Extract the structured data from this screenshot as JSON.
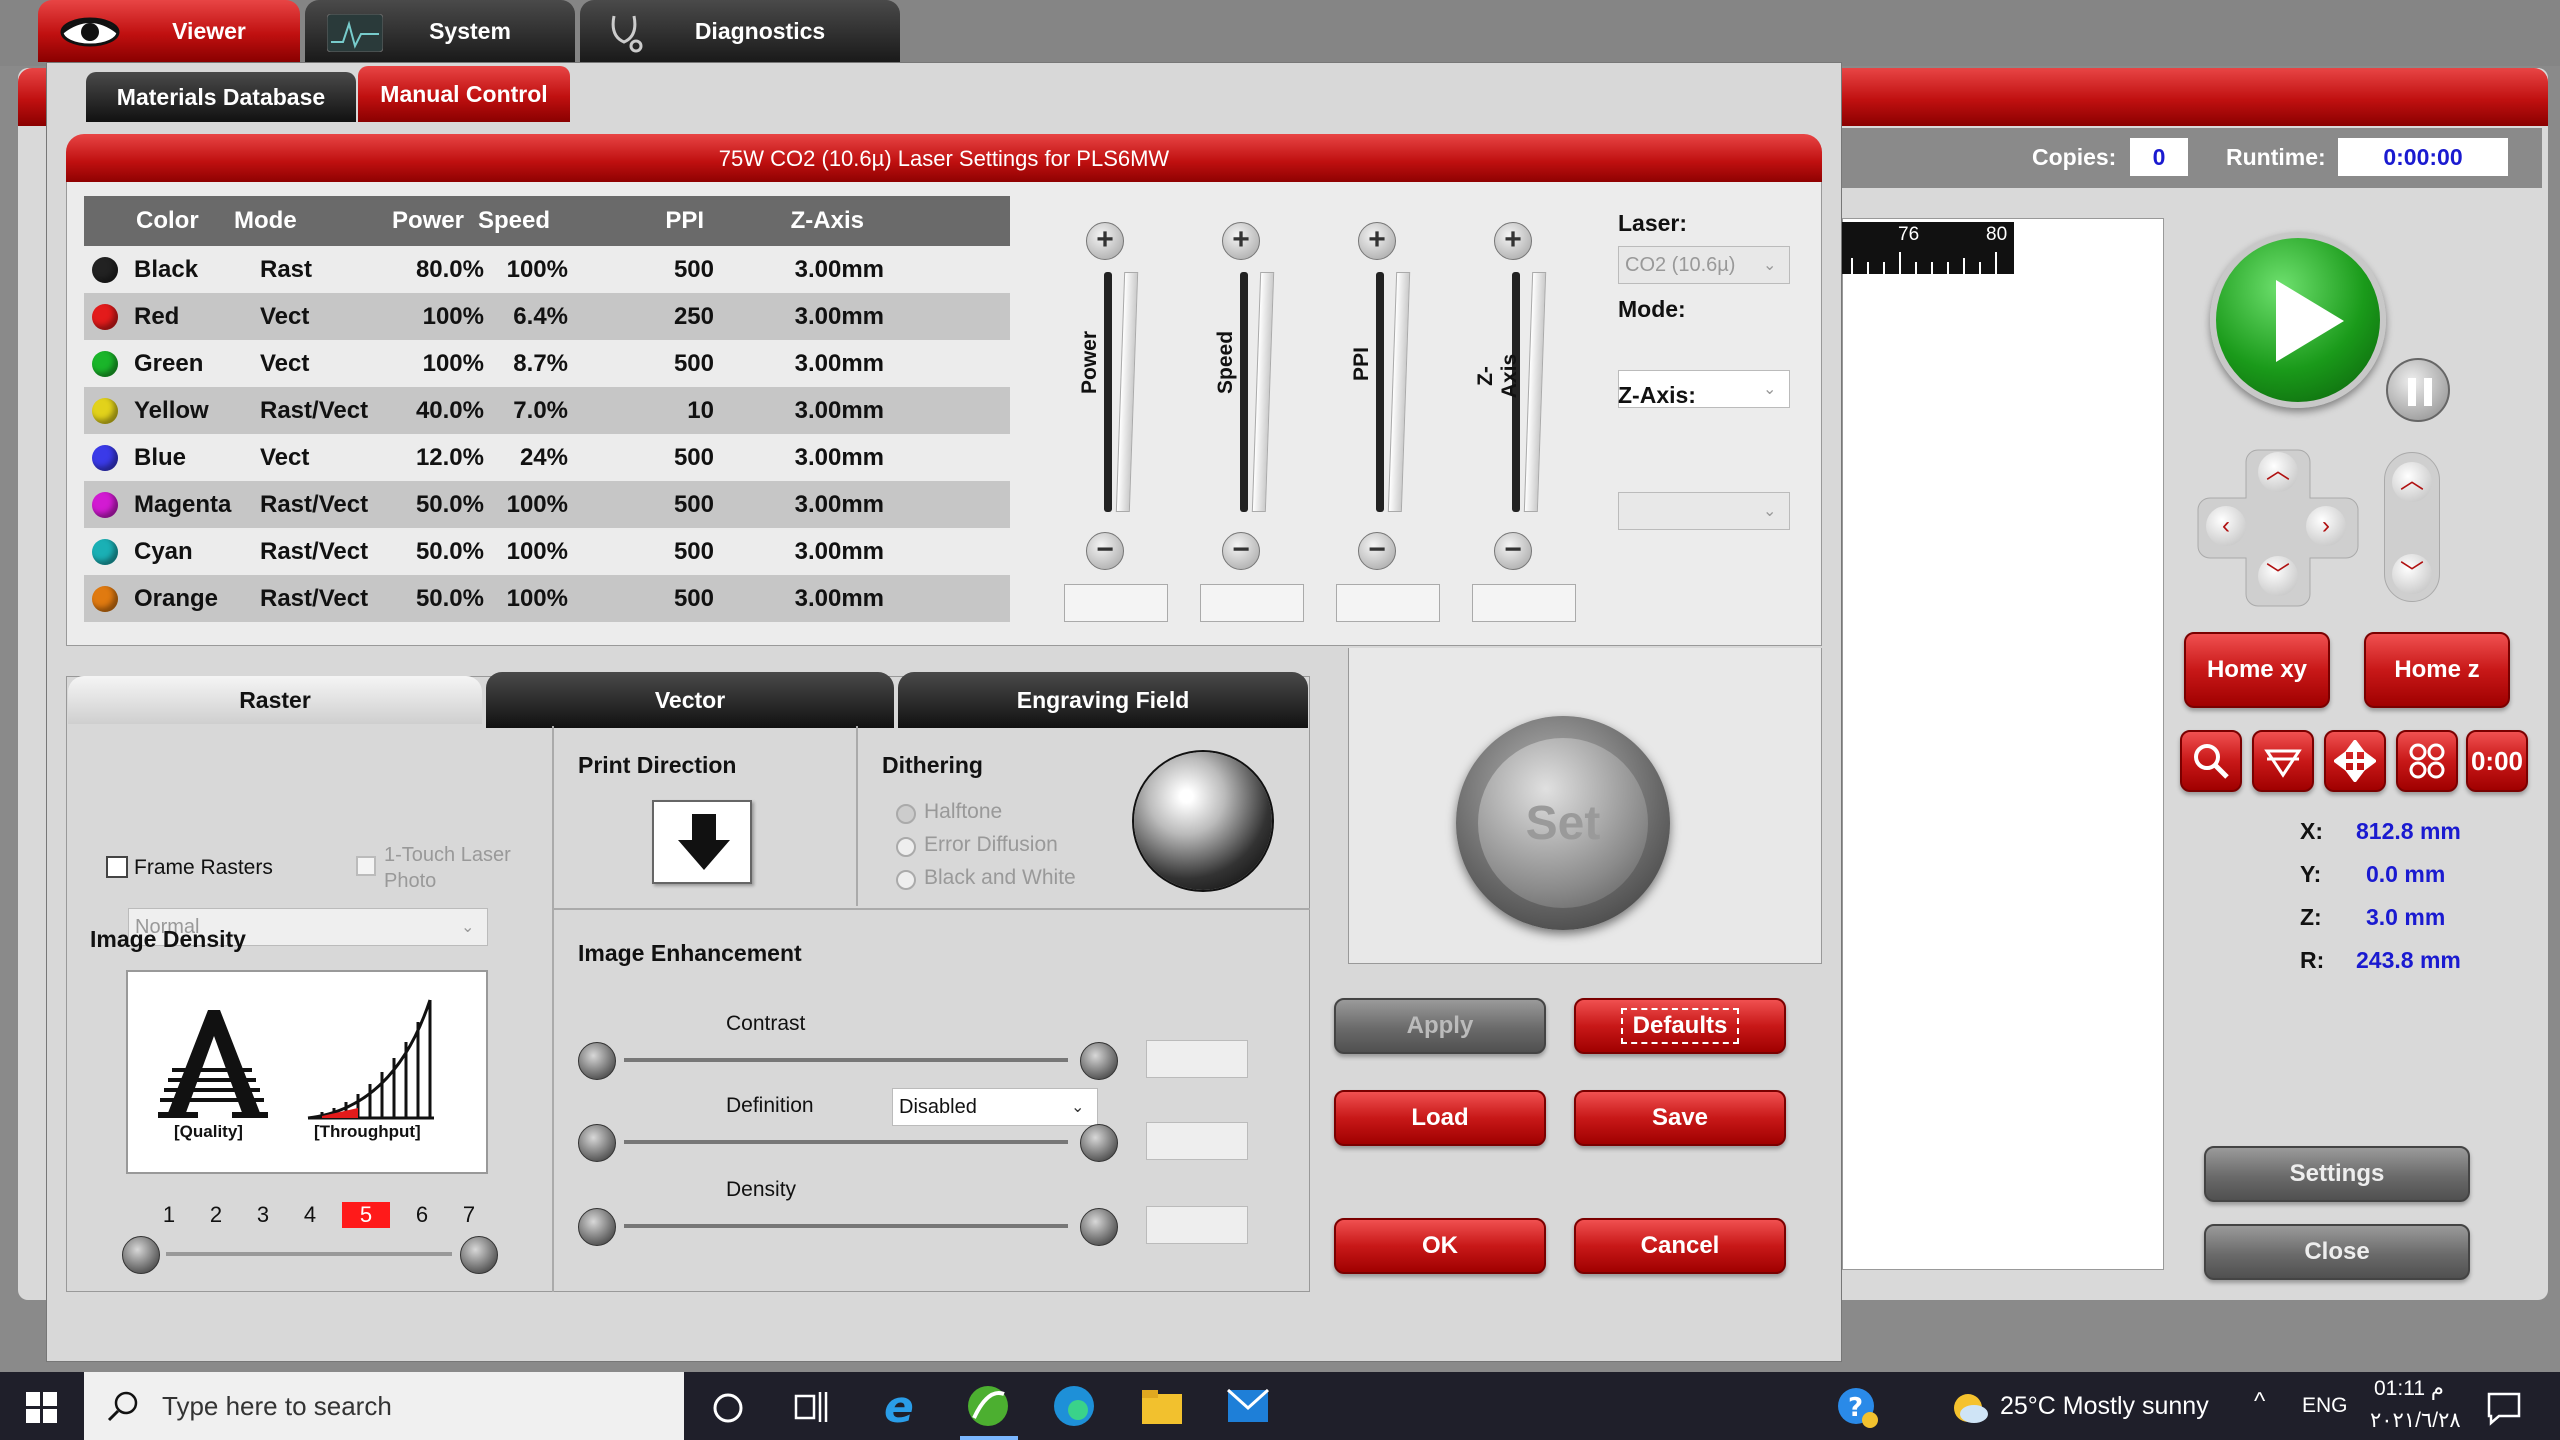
{
  "main_tabs": [
    "Viewer",
    "System",
    "Diagnostics"
  ],
  "sub_tabs": [
    "Materials Database",
    "Manual Control"
  ],
  "dialog_title": "75W CO2 (10.6µ) Laser Settings for PLS6MW",
  "table": {
    "headers": [
      "Color",
      "Mode",
      "Power",
      "Speed",
      "PPI",
      "Z-Axis"
    ],
    "rows": [
      {
        "color": "Black",
        "hex": "#222222",
        "mode": "Rast",
        "power": "80.0%",
        "speed": "100%",
        "ppi": "500",
        "z": "3.00mm"
      },
      {
        "color": "Red",
        "hex": "#e31b1b",
        "mode": "Vect",
        "power": "100%",
        "speed": "6.4%",
        "ppi": "250",
        "z": "3.00mm"
      },
      {
        "color": "Green",
        "hex": "#1ab52a",
        "mode": "Vect",
        "power": "100%",
        "speed": "8.7%",
        "ppi": "500",
        "z": "3.00mm"
      },
      {
        "color": "Yellow",
        "hex": "#e2d21b",
        "mode": "Rast/Vect",
        "power": "40.0%",
        "speed": "7.0%",
        "ppi": "10",
        "z": "3.00mm"
      },
      {
        "color": "Blue",
        "hex": "#3a3ae8",
        "mode": "Vect",
        "power": "12.0%",
        "speed": "24%",
        "ppi": "500",
        "z": "3.00mm"
      },
      {
        "color": "Magenta",
        "hex": "#d21bd2",
        "mode": "Rast/Vect",
        "power": "50.0%",
        "speed": "100%",
        "ppi": "500",
        "z": "3.00mm"
      },
      {
        "color": "Cyan",
        "hex": "#1ab0b5",
        "mode": "Rast/Vect",
        "power": "50.0%",
        "speed": "100%",
        "ppi": "500",
        "z": "3.00mm"
      },
      {
        "color": "Orange",
        "hex": "#e07a10",
        "mode": "Rast/Vect",
        "power": "50.0%",
        "speed": "100%",
        "ppi": "500",
        "z": "3.00mm"
      }
    ]
  },
  "sliders": [
    "Power",
    "Speed",
    "PPI",
    "Z-Axis"
  ],
  "laser_panel": {
    "laser_label": "Laser:",
    "laser_value": "CO2 (10.6µ)",
    "mode_label": "Mode:",
    "z_label": "Z-Axis:"
  },
  "set_button": "Set",
  "raster_tabs": [
    "Raster",
    "Vector",
    "Engraving Field"
  ],
  "raster": {
    "quality_select": "Normal",
    "frame_rasters": "Frame Rasters",
    "one_touch": "1-Touch Laser Photo",
    "image_density_label": "Image Density",
    "quality_caption": "[Quality]",
    "throughput_caption": "[Throughput]",
    "density_numbers": [
      "1",
      "2",
      "3",
      "4",
      "5",
      "6",
      "7"
    ],
    "density_selected": "5"
  },
  "print_direction_label": "Print Direction",
  "dithering": {
    "label": "Dithering",
    "options": [
      "Halftone",
      "Error Diffusion",
      "Black and White"
    ]
  },
  "enhancement": {
    "label": "Image Enhancement",
    "value": "Disabled",
    "sliders": [
      "Contrast",
      "Definition",
      "Density"
    ]
  },
  "buttons": {
    "apply": "Apply",
    "defaults": "Defaults",
    "load": "Load",
    "save": "Save",
    "ok": "OK",
    "cancel": "Cancel"
  },
  "header_right": {
    "copies_label": "Copies:",
    "copies_value": "0",
    "runtime_label": "Runtime:",
    "runtime_value": "0:00:00"
  },
  "ruler": [
    "76",
    "80"
  ],
  "home": {
    "xy": "Home xy",
    "z": "Home z"
  },
  "coords": [
    {
      "label": "X:",
      "value": "812.8 mm"
    },
    {
      "label": "Y:",
      "value": "0.0 mm"
    },
    {
      "label": "Z:",
      "value": "3.0 mm"
    },
    {
      "label": "R:",
      "value": "243.8 mm"
    }
  ],
  "timer_icon_text": "0:00",
  "side_buttons": {
    "settings": "Settings",
    "close": "Close"
  },
  "taskbar": {
    "search_placeholder": "Type here to search",
    "weather": "25°C  Mostly sunny",
    "lang": "ENG",
    "time": "01:11 م",
    "date": "٢٠٢١/٦/٢٨"
  }
}
